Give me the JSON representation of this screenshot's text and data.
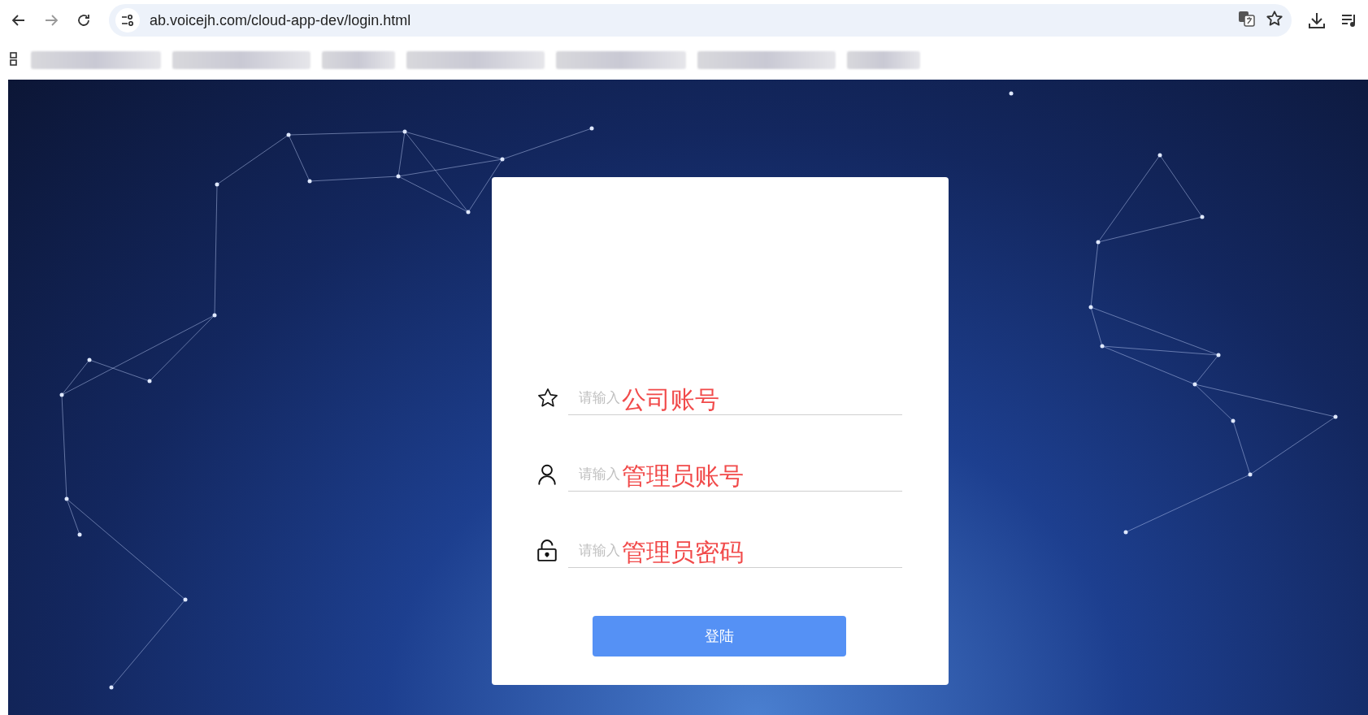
{
  "browser": {
    "url": "ab.voicejh.com/cloud-app-dev/login.html"
  },
  "login_form": {
    "fields": [
      {
        "kind": "company",
        "placeholder": "请输入",
        "annotation": "公司账号"
      },
      {
        "kind": "user",
        "placeholder": "请输入",
        "annotation": "管理员账号"
      },
      {
        "kind": "password",
        "placeholder": "请输入",
        "annotation": "管理员密码"
      }
    ],
    "submit_button": "登陆"
  }
}
